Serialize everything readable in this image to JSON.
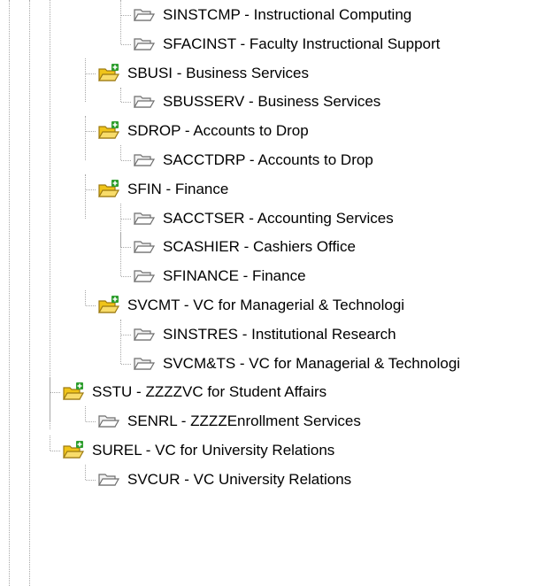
{
  "tree": {
    "nodes": [
      {
        "code": "SINSTCMP",
        "name": "Instructional Computing",
        "label": "SINSTCMP - Instructional Computing",
        "depth": 4,
        "icon": "folder-open-icon",
        "last": false
      },
      {
        "code": "SFACINST",
        "name": "Faculty Instructional Support",
        "label": "SFACINST - Faculty Instructional Support",
        "depth": 4,
        "icon": "folder-open-icon",
        "last": true
      },
      {
        "code": "SBUSI",
        "name": "Business Services",
        "label": "SBUSI - Business Services",
        "depth": 3,
        "icon": "folder-open-add-icon",
        "last": false
      },
      {
        "code": "SBUSSERV",
        "name": "Business Services",
        "label": "SBUSSERV - Business Services",
        "depth": 4,
        "icon": "folder-open-icon",
        "last": true
      },
      {
        "code": "SDROP",
        "name": "Accounts to Drop",
        "label": "SDROP - Accounts to Drop",
        "depth": 3,
        "icon": "folder-open-add-icon",
        "last": false
      },
      {
        "code": "SACCTDRP",
        "name": "Accounts to Drop",
        "label": "SACCTDRP - Accounts to Drop",
        "depth": 4,
        "icon": "folder-open-icon",
        "last": true
      },
      {
        "code": "SFIN",
        "name": "Finance",
        "label": "SFIN - Finance",
        "depth": 3,
        "icon": "folder-open-add-icon",
        "last": false
      },
      {
        "code": "SACCTSER",
        "name": "Accounting Services",
        "label": "SACCTSER - Accounting Services",
        "depth": 4,
        "icon": "folder-open-icon",
        "last": false
      },
      {
        "code": "SCASHIER",
        "name": "Cashiers Office",
        "label": "SCASHIER - Cashiers Office",
        "depth": 4,
        "icon": "folder-open-icon",
        "last": false
      },
      {
        "code": "SFINANCE",
        "name": "Finance",
        "label": "SFINANCE - Finance",
        "depth": 4,
        "icon": "folder-open-icon",
        "last": true
      },
      {
        "code": "SVCMT",
        "name": "VC for Managerial & Technologi",
        "label": "SVCMT - VC for Managerial & Technologi",
        "depth": 3,
        "icon": "folder-open-add-icon",
        "last": true
      },
      {
        "code": "SINSTRES",
        "name": "Institutional Research",
        "label": "SINSTRES - Institutional Research",
        "depth": 4,
        "icon": "folder-open-icon",
        "last": false
      },
      {
        "code": "SVCM&TS",
        "name": "VC for Managerial & Technologi",
        "label": "SVCM&TS - VC for Managerial & Technologi",
        "depth": 4,
        "icon": "folder-open-icon",
        "last": true
      },
      {
        "code": "SSTU",
        "name": "ZZZZVC for Student Affairs",
        "label": "SSTU - ZZZZVC for Student Affairs",
        "depth": 2,
        "icon": "folder-open-add-icon",
        "last": false
      },
      {
        "code": "SENRL",
        "name": "ZZZZEnrollment Services",
        "label": "SENRL - ZZZZEnrollment Services",
        "depth": 3,
        "icon": "folder-open-icon",
        "last": true
      },
      {
        "code": "SUREL",
        "name": "VC for University Relations",
        "label": "SUREL - VC for University Relations",
        "depth": 2,
        "icon": "folder-open-add-icon",
        "last": true
      },
      {
        "code": "SVCUR",
        "name": "VC University Relations",
        "label": "SVCUR - VC University Relations",
        "depth": 3,
        "icon": "folder-open-icon",
        "last": true
      }
    ]
  },
  "colors": {
    "connector": "#a8a8a8",
    "folder_outline": "#6e6e6e",
    "folder_fill": "#f2f2f2",
    "folder_yellow": "#f0c419",
    "plus_green": "#2e9e2e"
  }
}
